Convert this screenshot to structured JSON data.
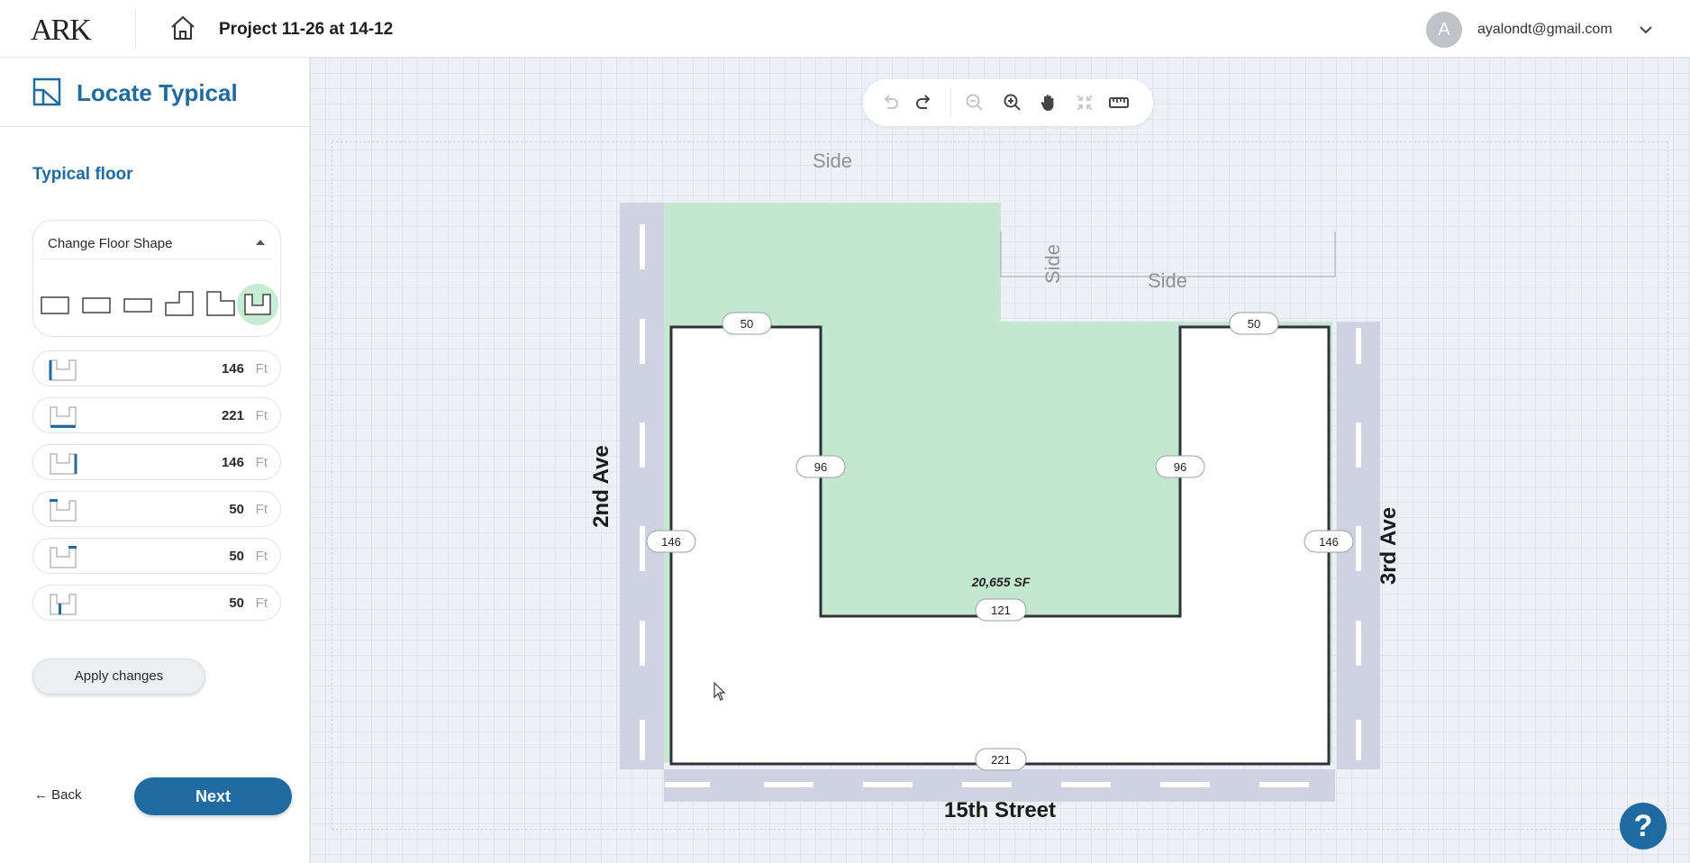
{
  "header": {
    "logo_text": "ARK",
    "project_title": "Project 11-26 at 14-12",
    "user": {
      "avatar_letter": "A",
      "email": "ayalondt@gmail.com"
    }
  },
  "panel": {
    "title": "Locate Typical",
    "section_title": "Typical floor",
    "shape_select_label": "Change Floor Shape",
    "shape_options": [
      "rectangle-wide",
      "rectangle",
      "rectangle-narrow",
      "step-shape",
      "l-shape",
      "u-shape"
    ],
    "selected_shape": "u-shape",
    "dimensions": [
      {
        "value": "146",
        "unit": "Ft"
      },
      {
        "value": "221",
        "unit": "Ft"
      },
      {
        "value": "146",
        "unit": "Ft"
      },
      {
        "value": "50",
        "unit": "Ft"
      },
      {
        "value": "50",
        "unit": "Ft"
      },
      {
        "value": "50",
        "unit": "Ft"
      }
    ],
    "apply_label": "Apply changes",
    "back_label": "← Back",
    "next_label": "Next"
  },
  "toolbar": {
    "tools": [
      "undo-icon",
      "redo-icon",
      "zoom-out-icon",
      "zoom-in-icon",
      "pan-hand-icon",
      "fit-view-icon",
      "ruler-icon"
    ]
  },
  "plan": {
    "side_labels": {
      "top": "Side",
      "notch_vertical": "Side",
      "notch_horizontal": "Side"
    },
    "streets": {
      "left": "2nd Ave",
      "right": "3rd Ave",
      "bottom": "15th Street"
    },
    "area_label": "20,655 SF",
    "dimension_labels": {
      "top_left": "50",
      "top_right": "50",
      "inner_left": "96",
      "inner_right": "96",
      "outer_left": "146",
      "outer_right": "146",
      "inner_bottom": "121",
      "bottom": "221"
    },
    "colors": {
      "lot_fill": "#c4e8cf",
      "building_fill": "#ffffff",
      "road": "#cfd3e1",
      "accent": "#1f6aa1"
    }
  },
  "help_label": "?"
}
